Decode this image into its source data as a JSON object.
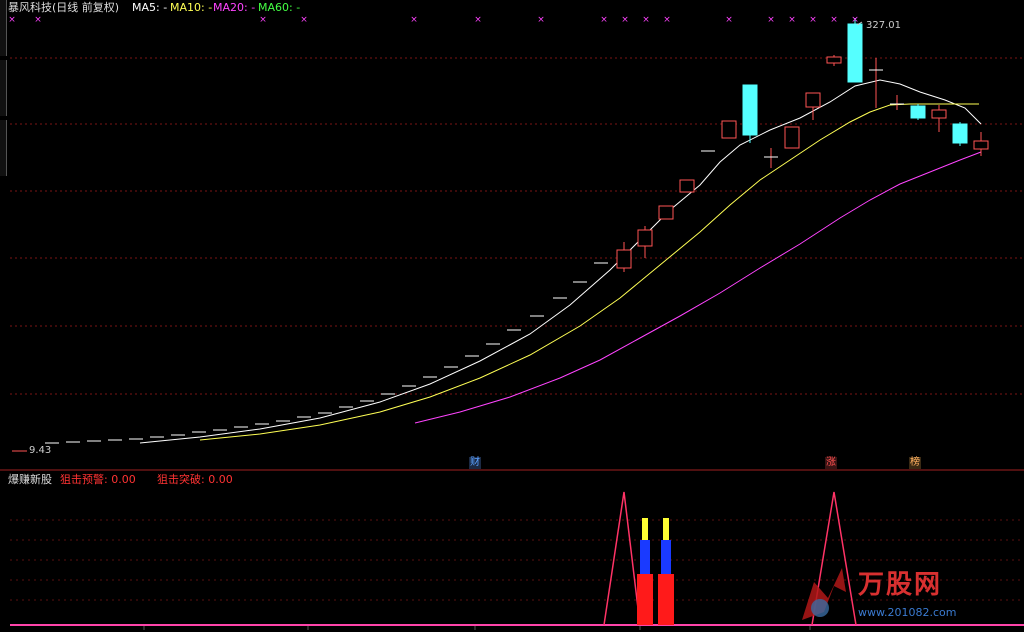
{
  "header": {
    "title": "暴风科技(日线 前复权)",
    "ma5_label": "MA5: -",
    "ma10_label": "MA10: -",
    "ma20_label": "MA20: -",
    "ma60_label": "MA60: -"
  },
  "price_panel": {
    "peak_label": "327.01",
    "low_label": "9.43",
    "events": [
      {
        "label": "财",
        "color": "#5aa0ff"
      },
      {
        "label": "涨",
        "color": "#ff5050"
      },
      {
        "label": "榜",
        "color": "#ffb060"
      }
    ]
  },
  "indicator_panel": {
    "name": "爆赚新股",
    "warn_label": "狙击预警: 0.00",
    "break_label": "狙击突破: 0.00"
  },
  "watermark": {
    "brand": "万股网",
    "url": "www.201082.com"
  },
  "colors": {
    "ma5": "#ffffff",
    "ma10": "#ffff55",
    "ma20": "#ff44ff",
    "up": "#ff5555",
    "down": "#55ffff",
    "grid": "#7a1414"
  }
}
